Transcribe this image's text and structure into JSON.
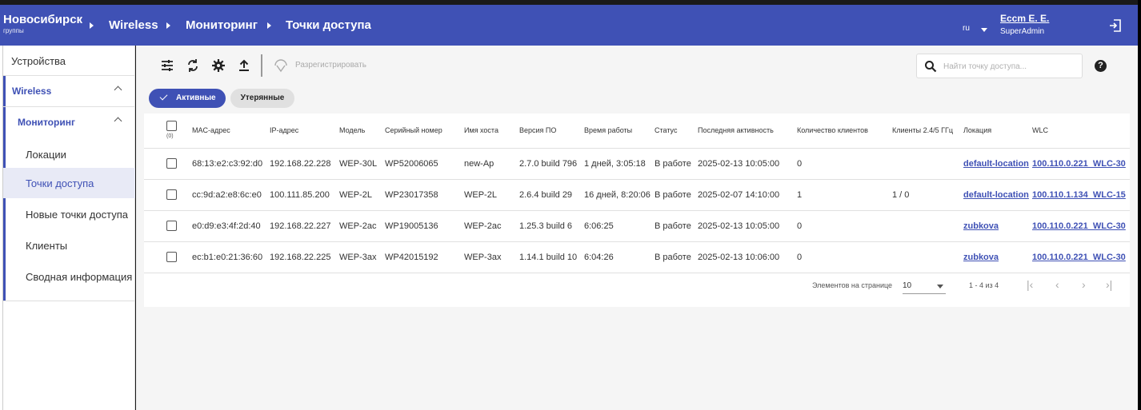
{
  "header": {
    "group_title": "Новосибирск",
    "group_subtitle": "группы",
    "breadcrumbs": [
      "Wireless",
      "Мониторинг",
      "Точки доступа"
    ],
    "language": "ru",
    "user_name": "Eccm E. E.",
    "user_role": "SuperAdmin"
  },
  "sidebar": {
    "devices": "Устройства",
    "wireless": "Wireless",
    "monitoring": "Мониторинг",
    "items": [
      "Локации",
      "Точки доступа",
      "Новые точки доступа",
      "Клиенты",
      "Сводная информация"
    ],
    "active_item": "Точки доступа"
  },
  "toolbar": {
    "unregister_label": "Разрегистрировать",
    "search_placeholder": "Найти точку доступа...",
    "help_label": "?"
  },
  "filters": {
    "active_label": "Активные",
    "lost_label": "Утерянные"
  },
  "table": {
    "selected_count": "(0)",
    "columns": [
      "MAC-адрес",
      "IP-адрес",
      "Модель",
      "Серийный номер",
      "Имя хоста",
      "Версия ПО",
      "Время работы",
      "Статус",
      "Последняя активность",
      "Количество клиентов",
      "Клиенты 2.4/5 ГГц",
      "Локация",
      "WLC"
    ],
    "rows": [
      {
        "mac": "68:13:e2:c3:92:d0",
        "ip": "192.168.22.228",
        "model": "WEP-30L",
        "serial": "WP52006065",
        "host": "new-Ap",
        "fw": "2.7.0 build 796",
        "uptime": "1 дней, 3:05:18",
        "status": "В работе",
        "last": "2025-02-13 10:05:00",
        "clients": "0",
        "clients_band": "",
        "location": "default-location",
        "wlc": "100.110.0.221_WLC-30"
      },
      {
        "mac": "cc:9d:a2:e8:6c:e0",
        "ip": "100.111.85.200",
        "model": "WEP-2L",
        "serial": "WP23017358",
        "host": "WEP-2L",
        "fw": "2.6.4 build 29",
        "uptime": "16 дней, 8:20:06",
        "status": "В работе",
        "last": "2025-02-07 14:10:00",
        "clients": "1",
        "clients_band": "1 / 0",
        "location": "default-location",
        "wlc": "100.110.1.134_WLC-15"
      },
      {
        "mac": "e0:d9:e3:4f:2d:40",
        "ip": "192.168.22.227",
        "model": "WEP-2ac",
        "serial": "WP19005136",
        "host": "WEP-2ac",
        "fw": "1.25.3 build 6",
        "uptime": "6:06:25",
        "status": "В работе",
        "last": "2025-02-13 10:05:00",
        "clients": "0",
        "clients_band": "",
        "location": "zubkova",
        "wlc": "100.110.0.221_WLC-30"
      },
      {
        "mac": "ec:b1:e0:21:36:60",
        "ip": "192.168.22.225",
        "model": "WEP-3ax",
        "serial": "WP42015192",
        "host": "WEP-3ax",
        "fw": "1.14.1 build 10",
        "uptime": "6:04:26",
        "status": "В работе",
        "last": "2025-02-13 10:06:00",
        "clients": "0",
        "clients_band": "",
        "location": "zubkova",
        "wlc": "100.110.0.221_WLC-30"
      }
    ]
  },
  "pagination": {
    "per_page_label": "Элементов на странице",
    "per_page_value": "10",
    "range": "1 - 4 из 4"
  },
  "colors": {
    "primary": "#3f51b5",
    "background": "#f5f5f5"
  }
}
